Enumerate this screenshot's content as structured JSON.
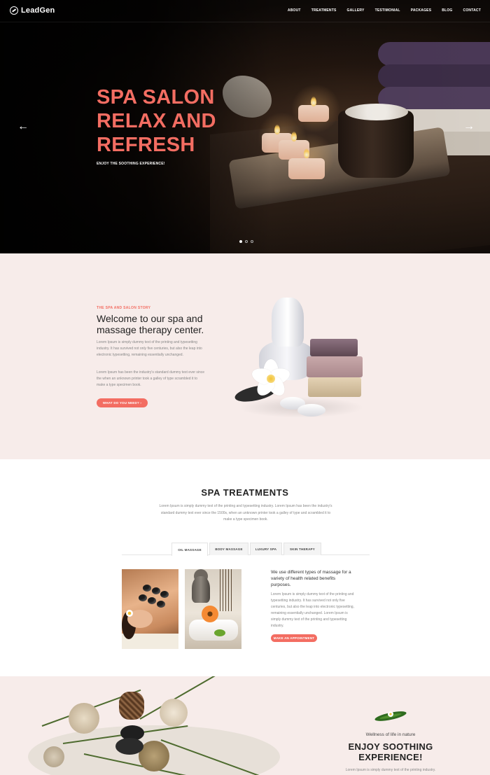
{
  "brand": {
    "name": "LeadGen"
  },
  "nav": {
    "items": [
      "ABOUT",
      "TREATMENTS",
      "GALLERY",
      "TESTIMONIAL",
      "PACKAGES",
      "BLOG",
      "CONTACT"
    ]
  },
  "hero": {
    "title_line1": "SPA SALON",
    "title_line2": "RELAX AND",
    "title_line3": "REFRESH",
    "subtitle": "ENJOY THE SOOTHING EXPERIENCE!",
    "slide_count": 3,
    "active_slide": 1,
    "accent_color": "#f36d62"
  },
  "about": {
    "kicker": "THE SPA AND SALON STORY",
    "heading": "Welcome to our spa and massage therapy center.",
    "paragraph1": "Lorem Ipsum is simply dummy text of the printing and typesetting industry. It has survived not only five centuries, but also the leap into electronic typesetting, remaining essentially unchanged.",
    "paragraph2": "Lorem Ipsum has been the industry's standard dummy text ever since the when an unknown printer took a galley of type scrambled it to make a type specimen book.",
    "button": "WHAT DO YOU NEED? ›"
  },
  "treatments": {
    "heading": "SPA TREATMENTS",
    "lead": "Lorem Ipsum is simply dummy text of the printing and typesetting industry. Lorem Ipsum has been the industry's standard dummy text ever since the 1500s, when an unknown printer took a galley of type and scrambled it to make a type specimen book.",
    "tabs": [
      "OIL MASSAGE",
      "BODY MASSAGE",
      "LUXURY SPA",
      "SKIN THERAPY"
    ],
    "active_tab": 0,
    "content_title": "We use different types of massage for a variety of health related benefits purposes.",
    "content_text": "Lorem Ipsum is simply dummy text of the printing and typesetting industry. It has survived not only five centuries, but also the leap into electronic typesetting, remaining essentially unchanged. Lorem Ipsum is simply dummy text of the printing and typesetting industry.",
    "button": "MAKE AN APPOINTMENT"
  },
  "bottom": {
    "kicker": "Wellness of life in nature",
    "heading_line1": "ENJOY SOOTHING",
    "heading_line2": "EXPERIENCE!",
    "text": "Lorem Ipsum is simply dummy text of the printing industry."
  },
  "icons": {
    "logo": "leadgen-logo-icon",
    "prev": "arrow-left-icon",
    "next": "arrow-right-icon",
    "leaf": "leaf-flower-icon"
  }
}
